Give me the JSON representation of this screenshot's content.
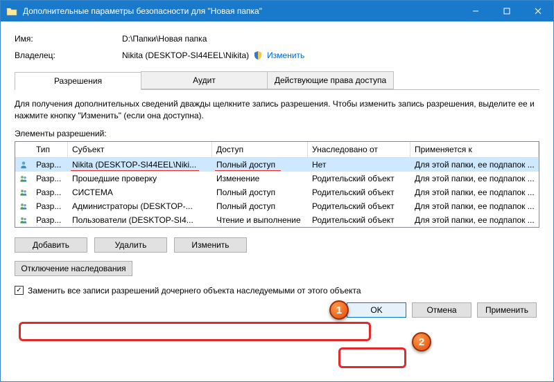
{
  "window": {
    "title": "Дополнительные параметры безопасности  для \"Новая папка\""
  },
  "info": {
    "name_label": "Имя:",
    "name_value": "D:\\Папки\\Новая папка",
    "owner_label": "Владелец:",
    "owner_value": "Nikita (DESKTOP-SI44EEL\\Nikita)",
    "change_link": "Изменить"
  },
  "tabs": {
    "t1": "Разрешения",
    "t2": "Аудит",
    "t3": "Действующие права доступа"
  },
  "help": "Для получения дополнительных сведений дважды щелкните запись разрешения. Чтобы изменить запись разрешения, выделите ее и нажмите кнопку \"Изменить\" (если она доступна).",
  "subheader": "Элементы разрешений:",
  "cols": {
    "type": "Тип",
    "subject": "Субъект",
    "access": "Доступ",
    "inherited": "Унаследовано от",
    "applies": "Применяется к"
  },
  "rows": [
    {
      "type": "Разр...",
      "subject": "Nikita (DESKTOP-SI44EEL\\Niki...",
      "access": "Полный доступ",
      "inherited": "Нет",
      "applies": "Для этой папки, ее подпапок ...",
      "icon": "single"
    },
    {
      "type": "Разр...",
      "subject": "Прошедшие проверку",
      "access": "Изменение",
      "inherited": "Родительский объект",
      "applies": "Для этой папки, ее подпапок ...",
      "icon": "group"
    },
    {
      "type": "Разр...",
      "subject": "СИСТЕМА",
      "access": "Полный доступ",
      "inherited": "Родительский объект",
      "applies": "Для этой папки, ее подпапок ...",
      "icon": "group"
    },
    {
      "type": "Разр...",
      "subject": "Администраторы (DESKTOP-...",
      "access": "Полный доступ",
      "inherited": "Родительский объект",
      "applies": "Для этой папки, ее подпапок ...",
      "icon": "group"
    },
    {
      "type": "Разр...",
      "subject": "Пользователи (DESKTOP-SI4...",
      "access": "Чтение и выполнение",
      "inherited": "Родительский объект",
      "applies": "Для этой папки, ее подпапок ...",
      "icon": "group"
    }
  ],
  "buttons": {
    "add": "Добавить",
    "remove": "Удалить",
    "edit": "Изменить",
    "disable_inh": "Отключение наследования",
    "ok": "OK",
    "cancel": "Отмена",
    "apply": "Применить"
  },
  "checkbox": {
    "label": "Заменить все записи разрешений дочернего объекта наследуемыми от этого объекта",
    "checked": true
  },
  "markers": {
    "m1": "1",
    "m2": "2"
  }
}
